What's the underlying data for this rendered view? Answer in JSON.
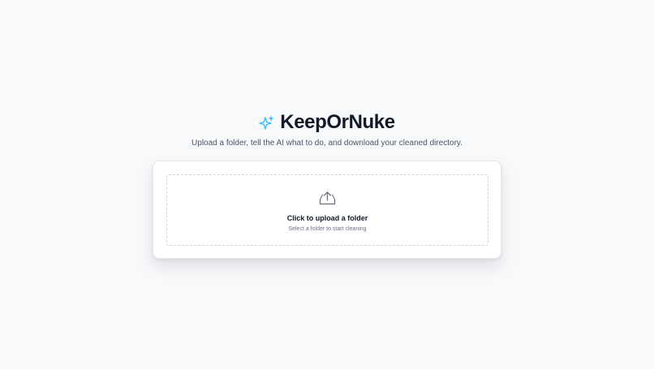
{
  "app": {
    "title": "KeepOrNuke",
    "subtitle": "Upload a folder, tell the AI what to do, and download your cleaned directory.",
    "icon": "sparkles-icon",
    "accent_color": "#38bdf8"
  },
  "upload": {
    "title": "Click to upload a folder",
    "hint": "Select a folder to start cleaning",
    "icon": "upload-icon"
  }
}
